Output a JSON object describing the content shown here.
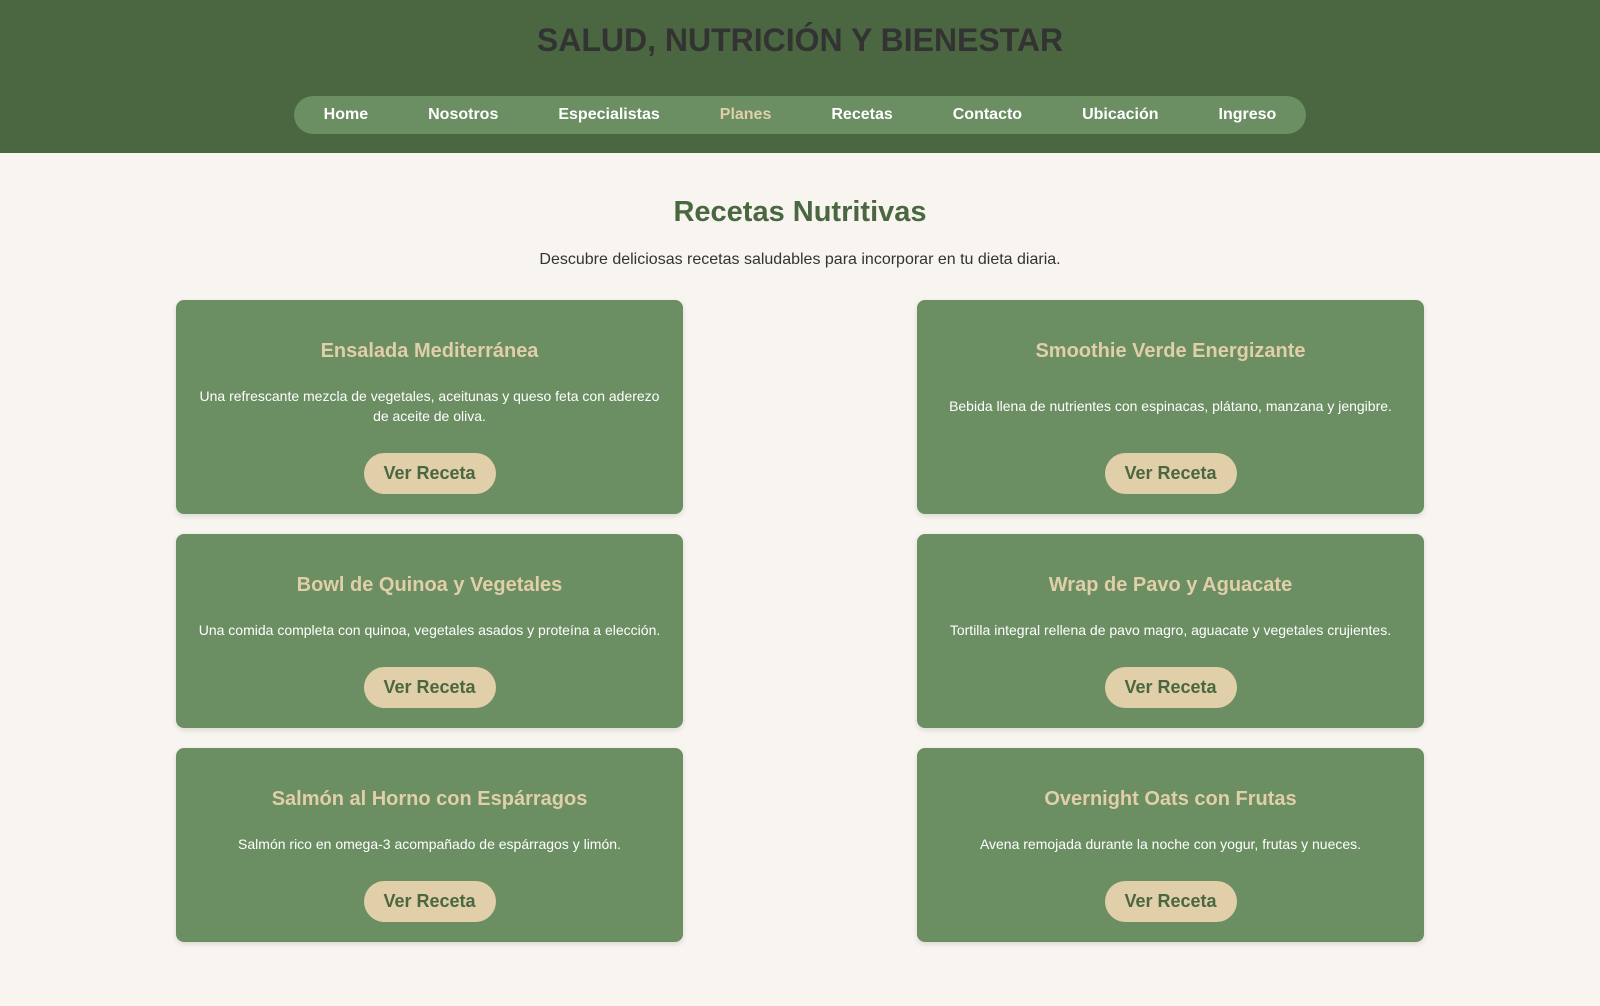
{
  "header": {
    "title": "SALUD, NUTRICIÓN Y BIENESTAR",
    "nav": [
      "Home",
      "Nosotros",
      "Especialistas",
      "Planes",
      "Recetas",
      "Contacto",
      "Ubicación",
      "Ingreso"
    ],
    "active_nav": "Planes"
  },
  "main": {
    "heading": "Recetas Nutritivas",
    "intro": "Descubre deliciosas recetas saludables para incorporar en tu dieta diaria.",
    "recipes": [
      {
        "title": "Ensalada Mediterránea",
        "description": "Una refrescante mezcla de vegetales, aceitunas y queso feta con aderezo de aceite de oliva.",
        "button": "Ver Receta"
      },
      {
        "title": "Smoothie Verde Energizante",
        "description": "Bebida llena de nutrientes con espinacas, plátano, manzana y jengibre.",
        "button": "Ver Receta"
      },
      {
        "title": "Bowl de Quinoa y Vegetales",
        "description": "Una comida completa con quinoa, vegetales asados y proteína a elección.",
        "button": "Ver Receta"
      },
      {
        "title": "Wrap de Pavo y Aguacate",
        "description": "Tortilla integral rellena de pavo magro, aguacate y vegetales crujientes.",
        "button": "Ver Receta"
      },
      {
        "title": "Salmón al Horno con Espárragos",
        "description": "Salmón rico en omega-3 acompañado de espárragos y limón.",
        "button": "Ver Receta"
      },
      {
        "title": "Overnight Oats con Frutas",
        "description": "Avena remojada durante la noche con yogur, frutas y nueces.",
        "button": "Ver Receta"
      }
    ]
  },
  "colors": {
    "header": "#4a6741",
    "nav": "#6b8e62",
    "accent": "#e0cfa8",
    "background": "#f8f5f0"
  }
}
